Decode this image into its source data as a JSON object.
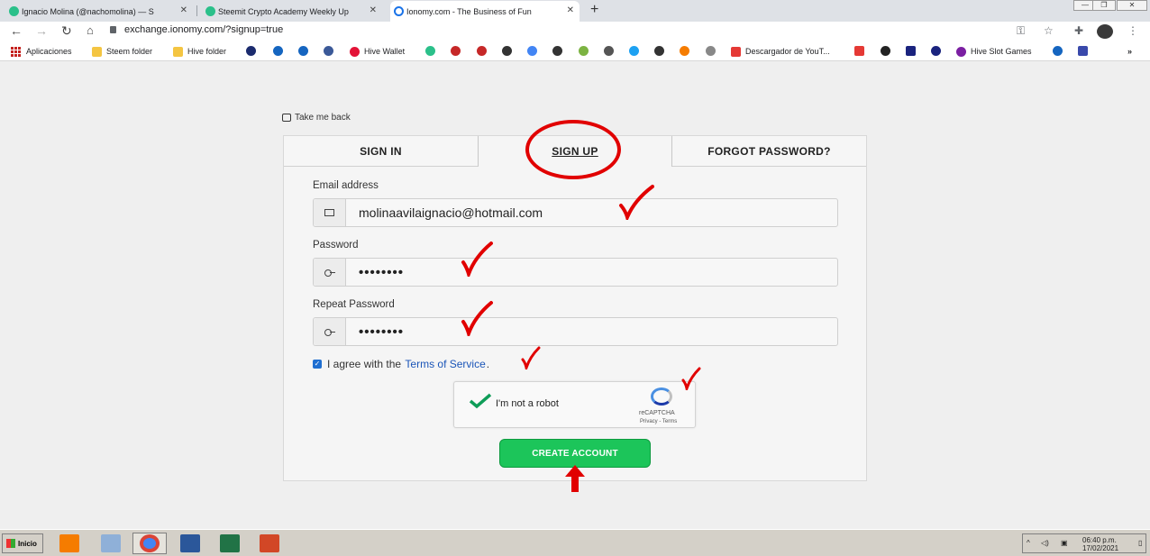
{
  "browser": {
    "tabs": [
      {
        "title": "Ignacio Molina (@nachomolina) — S",
        "color": "#2bc08a"
      },
      {
        "title": "Steemit Crypto Academy Weekly Up",
        "color": "#2bc08a"
      },
      {
        "title": "Ionomy.com - The Business of Fun",
        "color": "#1a73e8"
      }
    ],
    "new_tab": "+",
    "url": "exchange.ionomy.com/?signup=true",
    "window_controls": [
      "—",
      "❐",
      "✕"
    ]
  },
  "bookmarks": [
    {
      "label": "Aplicaciones",
      "color": "#c5221f"
    },
    {
      "label": "Steem folder",
      "color": "#f4c542"
    },
    {
      "label": "Hive folder",
      "color": "#f4c542"
    },
    {
      "label": "Hive Wallet",
      "color": "#e31337"
    },
    {
      "label": "Descargador de YouT...",
      "color": "#e53935"
    },
    {
      "label": "Hive Slot Games",
      "color": "#7b1fa2"
    }
  ],
  "bookmark_icons": [
    "#1b2b6e",
    "#1565c0",
    "#1565c0",
    "#3b5998",
    "#2bc08a",
    "#c62828",
    "#c62828",
    "#333333",
    "#4285f4",
    "#333333",
    "#7cb342",
    "#555555",
    "#1da1f2",
    "#333333",
    "#f57c00",
    "#888888",
    "#e53935",
    "#222222",
    "#1a237e",
    "#1a237e",
    "#1565c0",
    "#3949ab"
  ],
  "page": {
    "back_link": "Take me back",
    "tabs": {
      "signin": "SIGN IN",
      "signup": "SIGN UP",
      "forgot": "FORGOT PASSWORD?"
    },
    "email": {
      "label": "Email address",
      "value": "molinaavilaignacio@hotmail.com"
    },
    "password": {
      "label": "Password",
      "value": "••••••••"
    },
    "repeat_password": {
      "label": "Repeat Password",
      "value": "••••••••"
    },
    "agree": {
      "prefix": "I agree with the",
      "link": "Terms of Service",
      "suffix": ".",
      "checked": true
    },
    "captcha": {
      "label": "I'm not a robot",
      "brand": "reCAPTCHA",
      "links": "Privacy - Terms"
    },
    "create_button": "CREATE ACCOUNT",
    "accent_color": "#1cc55a",
    "annotation_color": "#e10000"
  },
  "taskbar": {
    "start": "Inicio",
    "apps": [
      {
        "name": "media-player",
        "color": "#f57c00"
      },
      {
        "name": "explorer",
        "color": "#8fb0d8"
      },
      {
        "name": "chrome",
        "color": "#4285f4"
      },
      {
        "name": "word",
        "color": "#2b579a"
      },
      {
        "name": "excel",
        "color": "#217346"
      },
      {
        "name": "powerpoint",
        "color": "#d24726"
      }
    ],
    "time": "06:40 p.m.",
    "date": "17/02/2021"
  }
}
